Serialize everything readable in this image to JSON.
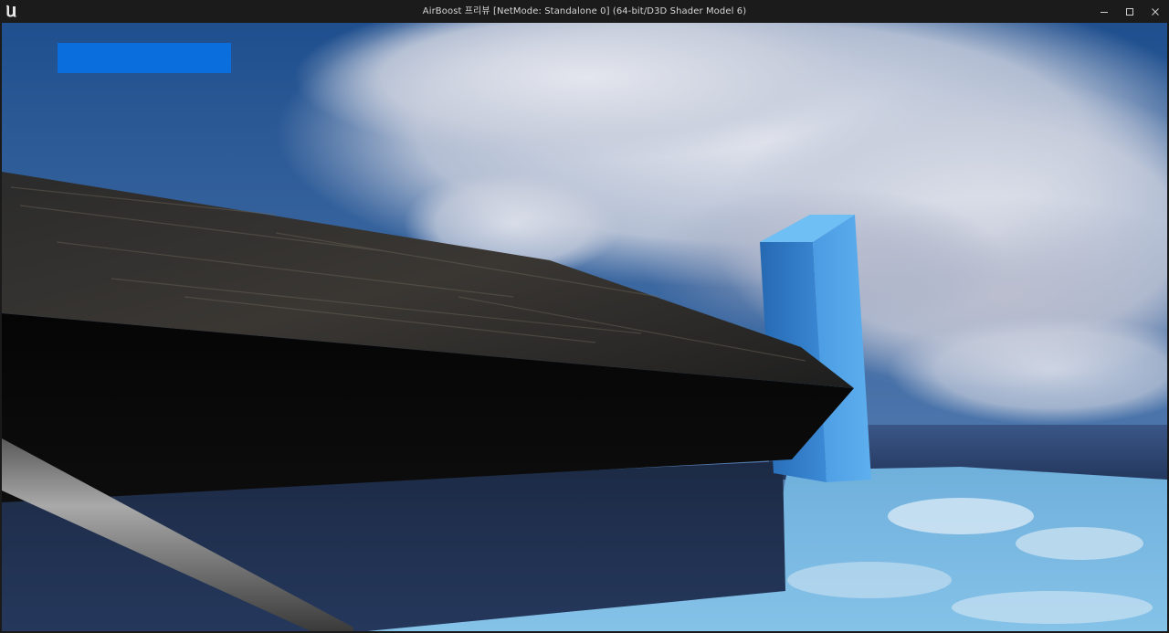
{
  "window": {
    "title": "AirBoost 프리뷰 [NetMode: Standalone 0]  (64-bit/D3D Shader Model 6)",
    "icons": {
      "app": "unreal-engine-logo-icon",
      "minimize": "minimize-icon",
      "maximize": "maximize-icon",
      "close": "close-icon"
    }
  },
  "hud": {
    "bar_color": "#0a6fdc",
    "bar_fill_fraction": 1.0
  },
  "scene": {
    "colors": {
      "sky_top": "#1f4f8e",
      "sky_horizon": "#5f86b8",
      "cloud": "#d7dbe6",
      "water_dark": "#2e4673",
      "floor_reflective": "#7ab8e0",
      "pillar_front": "#2f7fd0",
      "pillar_side": "#4ea0e6",
      "beam": "#111111",
      "pole": "#8a8a8a"
    }
  }
}
